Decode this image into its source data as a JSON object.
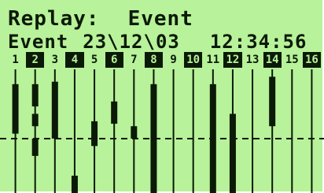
{
  "screen": {
    "title_label": "Replay:",
    "title_mode": "Event",
    "event_label": "Event",
    "date": "23\\12\\03",
    "time": "12:34:56"
  },
  "channels": [
    {
      "label": "1",
      "active": false
    },
    {
      "label": "2",
      "active": true
    },
    {
      "label": "3",
      "active": false
    },
    {
      "label": "4",
      "active": true
    },
    {
      "label": "5",
      "active": false
    },
    {
      "label": "6",
      "active": true
    },
    {
      "label": "7",
      "active": false
    },
    {
      "label": "8",
      "active": true
    },
    {
      "label": "9",
      "active": false
    },
    {
      "label": "10",
      "active": true
    },
    {
      "label": "11",
      "active": false
    },
    {
      "label": "12",
      "active": true
    },
    {
      "label": "13",
      "active": false
    },
    {
      "label": "14",
      "active": true
    },
    {
      "label": "15",
      "active": false
    },
    {
      "label": "16",
      "active": true
    }
  ],
  "traces": [
    {
      "channel": "1",
      "segments": [
        [
          0.12,
          0.52
        ]
      ]
    },
    {
      "channel": "2",
      "segments": [
        [
          0.12,
          0.3
        ],
        [
          0.36,
          0.46
        ],
        [
          0.56,
          0.7
        ]
      ]
    },
    {
      "channel": "3",
      "segments": [
        [
          0.1,
          0.56
        ]
      ]
    },
    {
      "channel": "4",
      "segments": [
        [
          0.86,
          1.0
        ]
      ]
    },
    {
      "channel": "5",
      "segments": [
        [
          0.42,
          0.62
        ]
      ]
    },
    {
      "channel": "6",
      "segments": [
        [
          0.26,
          0.44
        ]
      ]
    },
    {
      "channel": "7",
      "segments": [
        [
          0.46,
          0.56
        ]
      ]
    },
    {
      "channel": "8",
      "segments": [
        [
          0.12,
          1.0
        ]
      ]
    },
    {
      "channel": "9",
      "segments": []
    },
    {
      "channel": "10",
      "segments": []
    },
    {
      "channel": "11",
      "segments": [
        [
          0.12,
          1.0
        ]
      ]
    },
    {
      "channel": "12",
      "segments": [
        [
          0.36,
          1.0
        ]
      ]
    },
    {
      "channel": "13",
      "segments": []
    },
    {
      "channel": "14",
      "segments": [
        [
          0.06,
          0.46
        ]
      ]
    },
    {
      "channel": "15",
      "segments": []
    },
    {
      "channel": "16",
      "segments": []
    }
  ],
  "colors": {
    "lcd_background": "#b8f29a",
    "lcd_foreground": "#0b1a07"
  }
}
